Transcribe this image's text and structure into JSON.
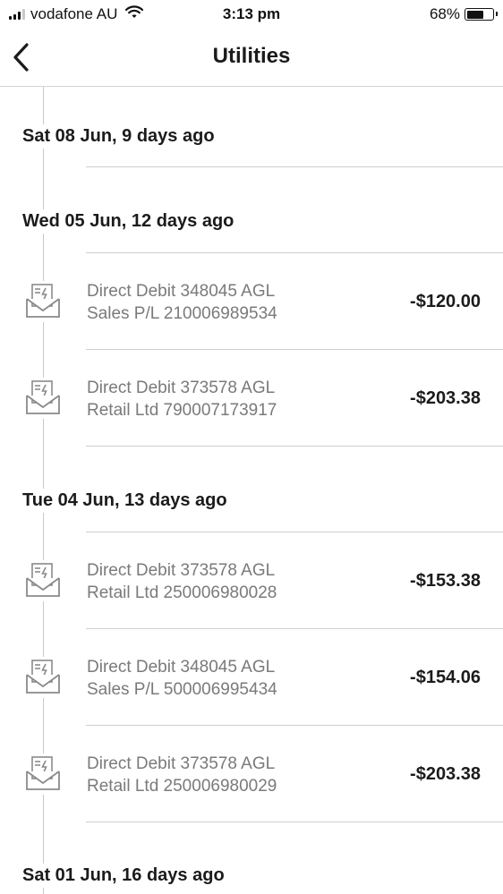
{
  "status_bar": {
    "carrier": "vodafone AU",
    "time": "3:13 pm",
    "battery_percent": "68%",
    "battery_level": 0.68
  },
  "nav": {
    "title": "Utilities",
    "back_icon": "chevron-left-icon"
  },
  "groups": [
    {
      "date": "Sat 08 Jun, 9 days ago",
      "transactions": []
    },
    {
      "date": "Wed 05 Jun, 12 days ago",
      "transactions": [
        {
          "line1": "Direct Debit 348045 AGL",
          "line2": "Sales P/L 210006989534",
          "amount": "-$120.00",
          "icon": "bill-envelope-icon"
        },
        {
          "line1": "Direct Debit 373578 AGL",
          "line2": "Retail Ltd 790007173917",
          "amount": "-$203.38",
          "icon": "bill-envelope-icon"
        }
      ]
    },
    {
      "date": "Tue 04 Jun, 13 days ago",
      "transactions": [
        {
          "line1": "Direct Debit 373578 AGL",
          "line2": "Retail Ltd 250006980028",
          "amount": "-$153.38",
          "icon": "bill-envelope-icon"
        },
        {
          "line1": "Direct Debit 348045 AGL",
          "line2": "Sales P/L 500006995434",
          "amount": "-$154.06",
          "icon": "bill-envelope-icon"
        },
        {
          "line1": "Direct Debit 373578 AGL",
          "line2": "Retail Ltd 250006980029",
          "amount": "-$203.38",
          "icon": "bill-envelope-icon"
        }
      ]
    },
    {
      "date": "Sat 01 Jun, 16 days ago",
      "transactions": []
    }
  ]
}
